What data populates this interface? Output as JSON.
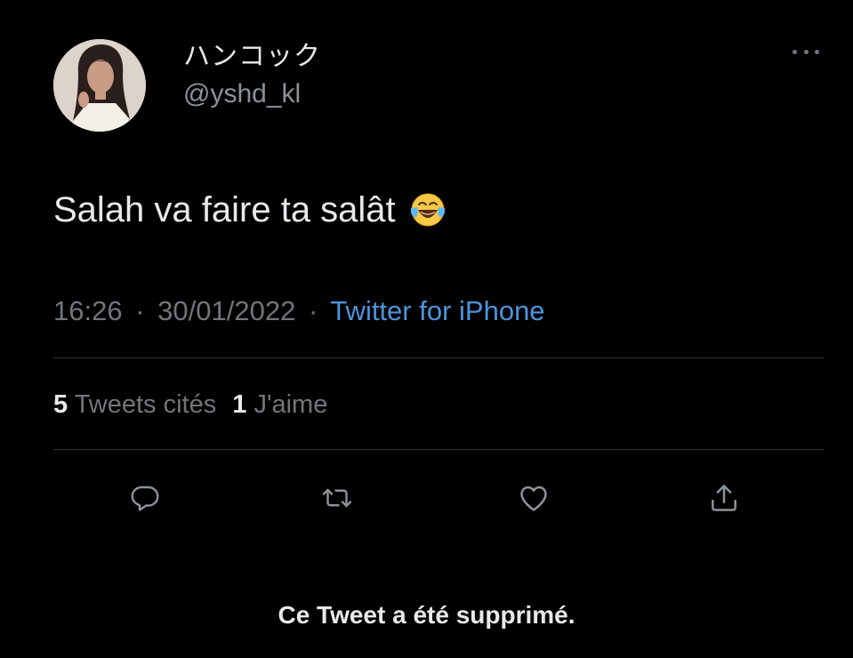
{
  "author": {
    "display_name": "ハンコック",
    "handle": "@yshd_kl",
    "avatar_icon": "profile-photo"
  },
  "tweet": {
    "text": "Salah va faire ta salât",
    "emoji": "face-with-tears-of-joy"
  },
  "meta": {
    "time": "16:26",
    "separator": "·",
    "date": "30/01/2022",
    "source": "Twitter for iPhone"
  },
  "stats": {
    "quote_count": "5",
    "quote_label": "Tweets cités",
    "like_count": "1",
    "like_label": "J'aime"
  },
  "actions": {
    "reply_icon": "reply-icon",
    "retweet_icon": "retweet-icon",
    "like_icon": "heart-icon",
    "share_icon": "share-icon"
  },
  "notice": "Ce Tweet a été supprimé.",
  "colors": {
    "background": "#000000",
    "primary_text": "#e7e9ea",
    "secondary_text": "#71767b",
    "link": "#4d94dc",
    "divider": "#2f3336"
  }
}
